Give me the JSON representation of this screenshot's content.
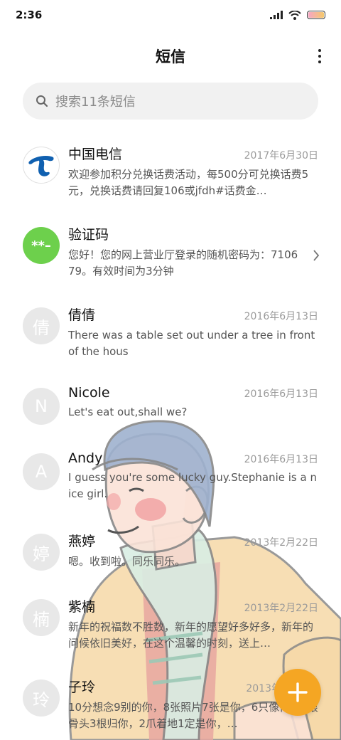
{
  "status_bar": {
    "time": "2:36"
  },
  "header": {
    "title": "短信"
  },
  "search": {
    "placeholder": "搜索11条短信"
  },
  "messages": [
    {
      "name": "中国电信",
      "date": "2017年6月30日",
      "preview": "欢迎参加积分兑换话费活动，每500分可兑换话费5元，兑换话费请回复106或jfdh#话费金…",
      "avatar_icon": "china-telecom-logo"
    },
    {
      "name": "验证码",
      "date": "",
      "preview": "您好！您的网上营业厅登录的随机密码为：710679。有效时间为3分钟",
      "avatar": "**–"
    },
    {
      "name": "倩倩",
      "date": "2016年6月13日",
      "preview": "There was a table set out under a tree in front of the hous",
      "avatar": "倩"
    },
    {
      "name": "Nicole",
      "date": "2016年6月13日",
      "preview": "Let's eat out,shall we?",
      "avatar": "N"
    },
    {
      "name": "Andy",
      "date": "2016年6月13日",
      "preview": "I guess you're some lucky guy.Stephanie is a nice girl.",
      "avatar": "A"
    },
    {
      "name": "燕婷",
      "date": "2013年2月22日",
      "preview": "嗯。收到啦。同乐同乐。",
      "avatar": "婷"
    },
    {
      "name": "紫楠",
      "date": "2013年2月22日",
      "preview": "新年的祝福数不胜数，新年的愿望好多好多，新年的问候依旧美好，在这个温馨的时刻，送上…",
      "avatar": "楠"
    },
    {
      "name": "子玲",
      "date": "2013年",
      "preview": "10分想念9别的你，8张照片7张是你，6只像你，4根骨头3根归你，2爪着地1定是你，…",
      "avatar": "玲"
    }
  ],
  "colors": {
    "accent": "#f5a623",
    "verify_avatar": "#6dd04c",
    "telecom_blue": "#1060b0",
    "avatar_gray": "#e8e8e8"
  },
  "icons": {
    "signal": "signal-icon",
    "wifi": "wifi-icon",
    "battery": "battery-icon",
    "more": "more-vertical-icon",
    "search": "search-icon",
    "chevron": "chevron-right-icon",
    "compose": "plus-icon"
  }
}
